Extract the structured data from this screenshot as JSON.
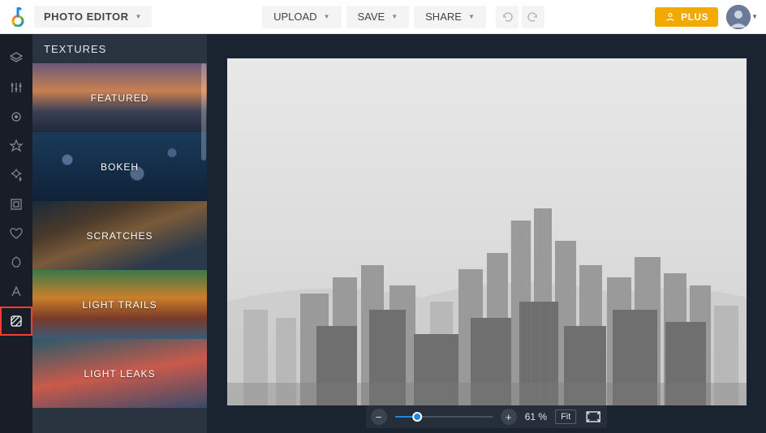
{
  "header": {
    "mode_label": "PHOTO EDITOR",
    "upload_label": "UPLOAD",
    "save_label": "SAVE",
    "share_label": "SHARE",
    "plus_label": "PLUS"
  },
  "sidebar": {
    "title": "TEXTURES",
    "tools": [
      {
        "name": "layers-icon"
      },
      {
        "name": "sliders-icon"
      },
      {
        "name": "eye-icon"
      },
      {
        "name": "star-icon"
      },
      {
        "name": "sparkle-icon"
      },
      {
        "name": "frame-icon"
      },
      {
        "name": "heart-icon"
      },
      {
        "name": "shape-icon"
      },
      {
        "name": "text-icon"
      },
      {
        "name": "textures-icon"
      }
    ],
    "items": [
      {
        "label": "FEATURED"
      },
      {
        "label": "BOKEH"
      },
      {
        "label": "SCRATCHES"
      },
      {
        "label": "LIGHT TRAILS"
      },
      {
        "label": "LIGHT LEAKS"
      }
    ]
  },
  "zoom": {
    "percent_label": "61 %",
    "fit_label": "Fit"
  }
}
